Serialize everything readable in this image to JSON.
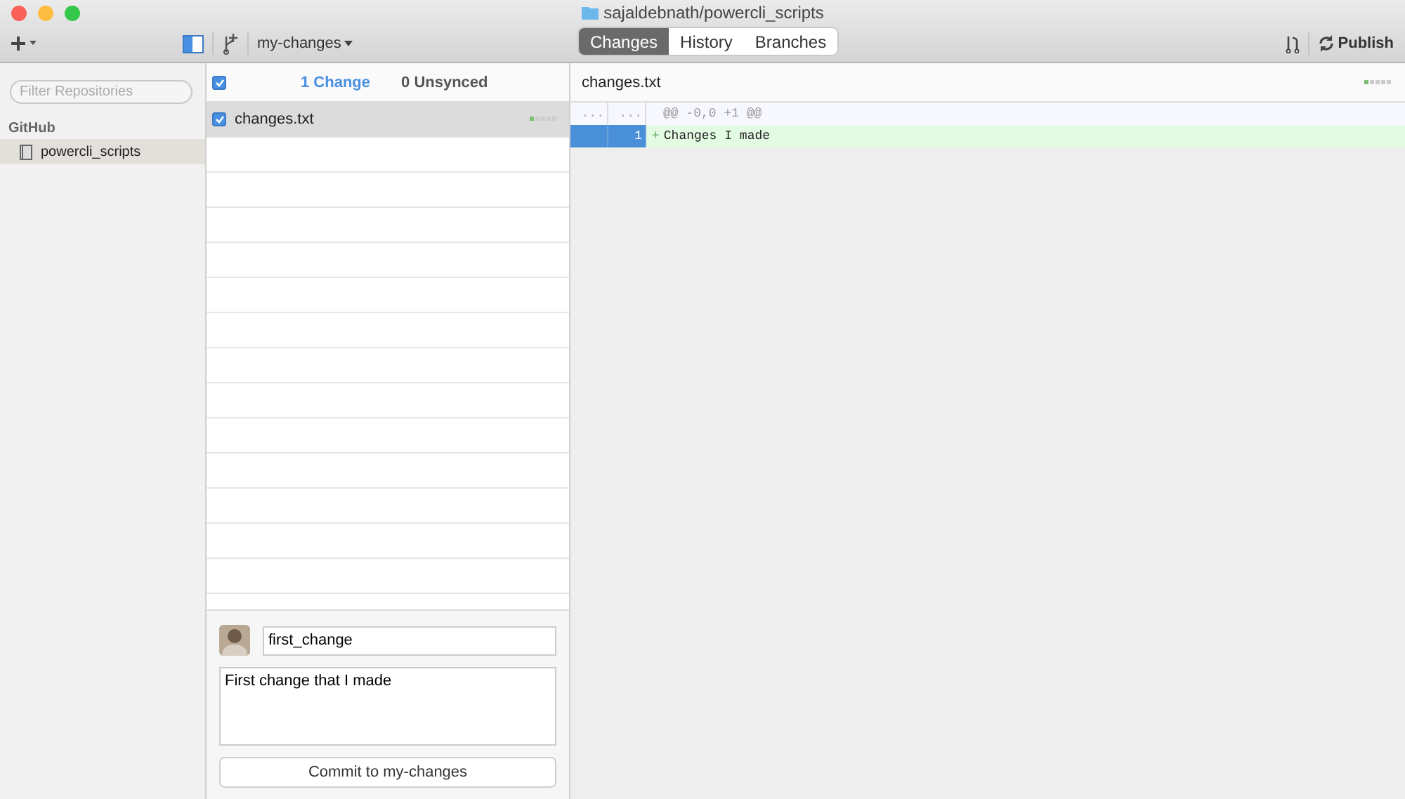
{
  "window": {
    "title": "sajaldebnath/powercli_scripts"
  },
  "toolbar": {
    "branch": "my-changes",
    "publish": "Publish"
  },
  "tabs": [
    {
      "label": "Changes",
      "selected": true
    },
    {
      "label": "History",
      "selected": false
    },
    {
      "label": "Branches",
      "selected": false
    }
  ],
  "sidebar": {
    "filter_placeholder": "Filter Repositories",
    "section": "GitHub",
    "items": [
      {
        "label": "powercli_scripts",
        "selected": true
      }
    ]
  },
  "changes_header": {
    "all_checked": true,
    "change_count": "1 Change",
    "unsynced": "0 Unsynced"
  },
  "files": [
    {
      "name": "changes.txt",
      "checked": true,
      "selected": true
    }
  ],
  "commit": {
    "summary": "first_change",
    "description": "First change that I made",
    "button": "Commit to my-changes"
  },
  "diff": {
    "filename": "changes.txt",
    "hunk": {
      "old": "...",
      "new": "...",
      "text": "@@ -0,0 +1 @@"
    },
    "lines": [
      {
        "kind": "added",
        "new": "1",
        "sign": "+",
        "text": "Changes I made",
        "selected": true
      }
    ]
  }
}
